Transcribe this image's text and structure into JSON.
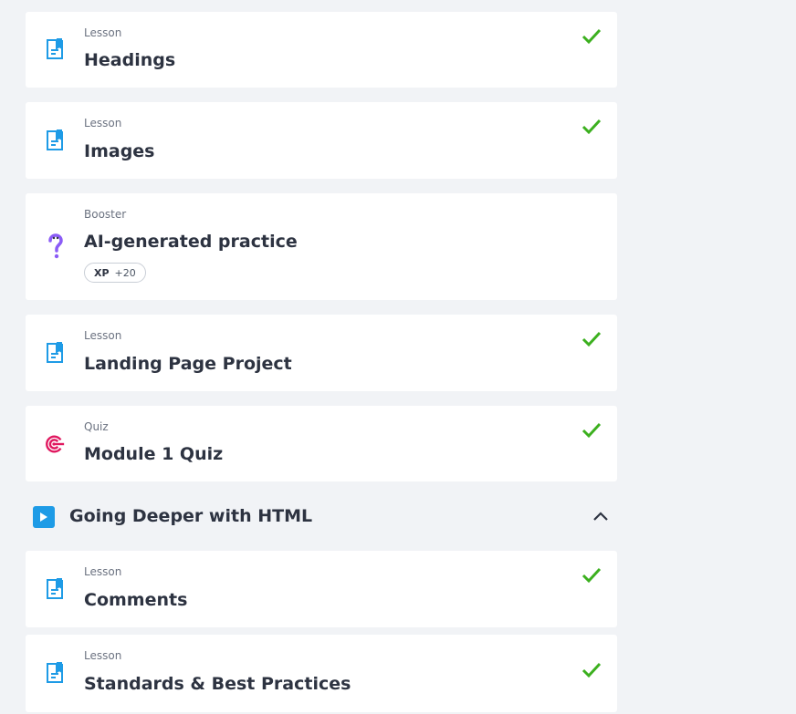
{
  "items_top": [
    {
      "type": "Lesson",
      "title": "Headings",
      "icon": "lesson-doc-icon",
      "completed": true
    },
    {
      "type": "Lesson",
      "title": "Images",
      "icon": "lesson-doc-icon",
      "completed": true
    },
    {
      "type": "Booster",
      "title": "AI-generated practice",
      "icon": "question-mark-icon",
      "completed": false,
      "xp_label": "XP",
      "xp_value": "+20"
    },
    {
      "type": "Lesson",
      "title": "Landing Page Project",
      "icon": "lesson-doc-icon",
      "completed": true
    },
    {
      "type": "Quiz",
      "title": "Module 1 Quiz",
      "icon": "target-icon",
      "completed": true
    }
  ],
  "section": {
    "title": "Going Deeper with HTML",
    "expanded": true
  },
  "items_bottom": [
    {
      "type": "Lesson",
      "title": "Comments",
      "icon": "lesson-doc-icon",
      "completed": true
    },
    {
      "type": "Lesson",
      "title": "Standards & Best Practices",
      "icon": "lesson-doc-icon",
      "completed": true
    }
  ],
  "colors": {
    "accent": "#1e9be6",
    "check": "#3cb01f",
    "quiz": "#e0185f",
    "booster": "#8b5cf6"
  }
}
